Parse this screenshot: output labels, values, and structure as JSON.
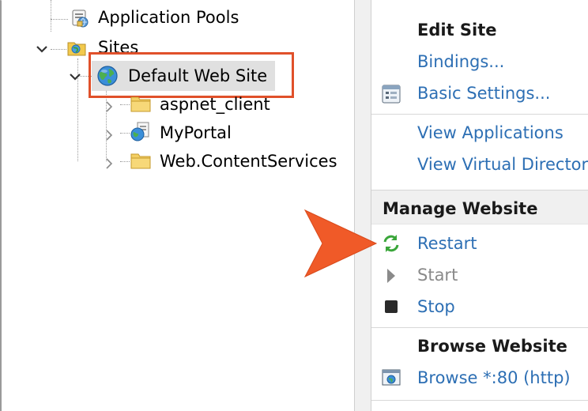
{
  "tree": {
    "items": [
      {
        "label": "Application Pools"
      },
      {
        "label": "Sites"
      },
      {
        "label": "Default Web Site"
      },
      {
        "label": "aspnet_client"
      },
      {
        "label": "MyPortal"
      },
      {
        "label": "Web.ContentServices"
      }
    ]
  },
  "actions": {
    "edit_site": {
      "header": "Edit Site",
      "bindings": "Bindings...",
      "basic_settings": "Basic Settings...",
      "view_applications": "View Applications",
      "view_virtual_directories": "View Virtual Directories"
    },
    "manage_website": {
      "header": "Manage Website",
      "restart": "Restart",
      "start": "Start",
      "stop": "Stop"
    },
    "browse_website": {
      "header": "Browse Website",
      "browse_80": "Browse *:80 (http)"
    }
  },
  "colors": {
    "highlight_border": "#e0502a",
    "arrow": "#f05a28",
    "link": "#2d6fb4",
    "disabled": "#8a8a8a",
    "section_bg": "#f0f0f0"
  },
  "icons": {
    "application_pools": "app-pool-icon",
    "sites": "sites-folder-icon",
    "default_web_site": "globe-icon",
    "aspnet_client": "folder-icon",
    "myportal": "web-app-icon",
    "web_contentservices": "folder-icon",
    "basic_settings": "settings-doc-icon",
    "restart": "restart-icon",
    "start": "start-icon",
    "stop": "stop-icon",
    "browse": "browse-icon"
  }
}
